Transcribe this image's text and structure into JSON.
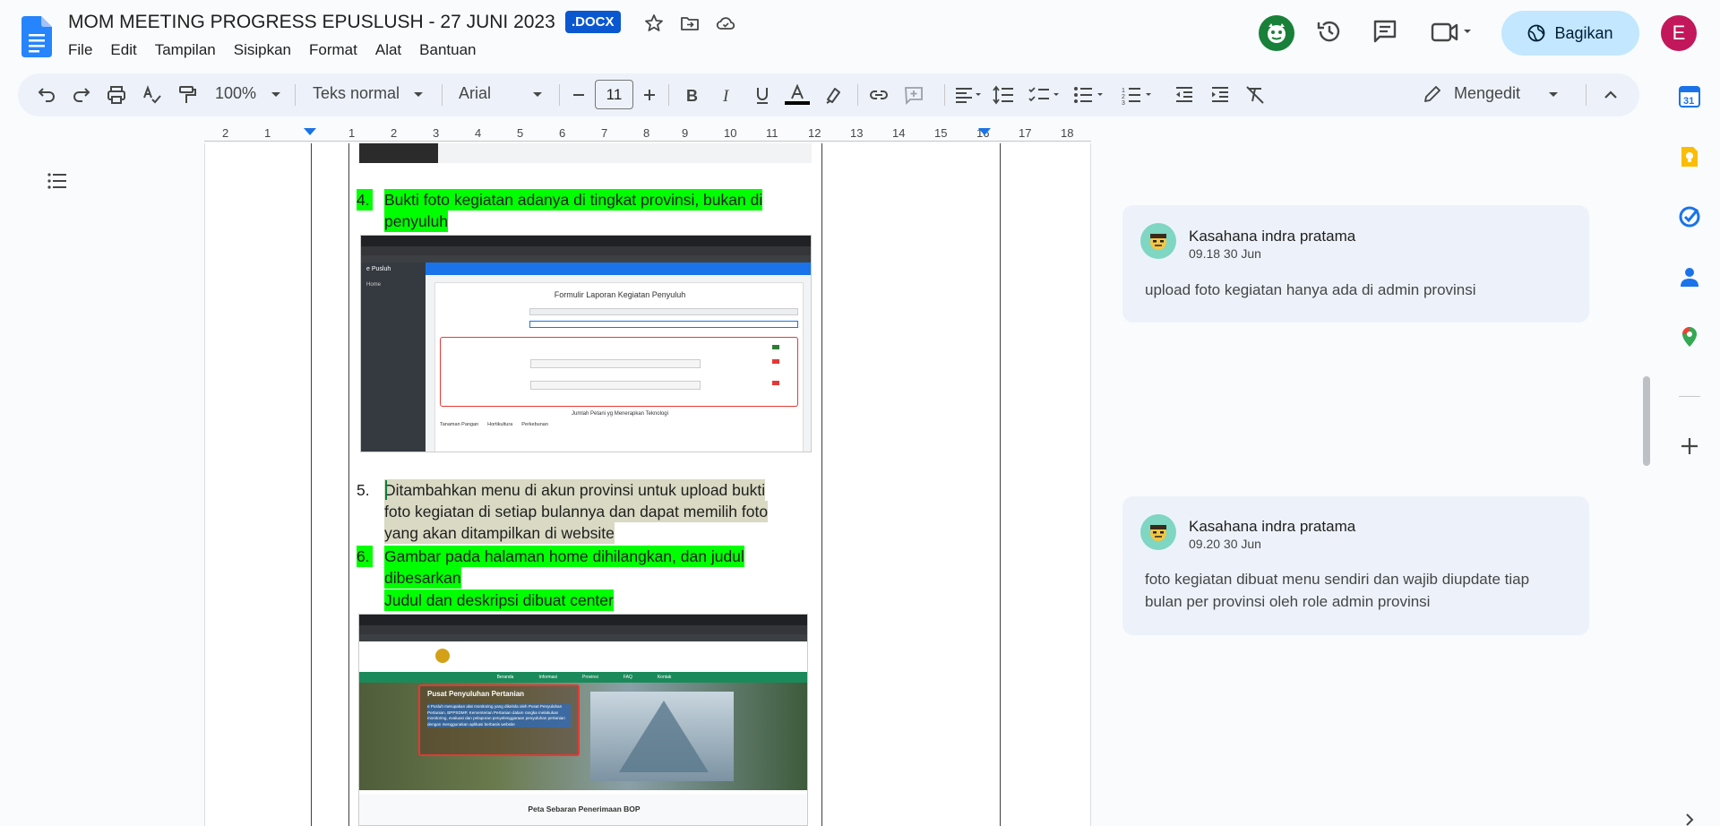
{
  "header": {
    "title": "MOM MEETING PROGRESS EPUSLUSH - 27 JUNI 2023",
    "badge": ".DOCX",
    "menu": [
      "File",
      "Edit",
      "Tampilan",
      "Sisipkan",
      "Format",
      "Alat",
      "Bantuan"
    ],
    "share_label": "Bagikan",
    "account_initial": "E"
  },
  "toolbar": {
    "zoom": "100%",
    "style": "Teks normal",
    "font": "Arial",
    "font_size": "11",
    "mode": "Mengedit"
  },
  "ruler": {
    "numbers": [
      "2",
      "1",
      "1",
      "2",
      "3",
      "4",
      "5",
      "6",
      "7",
      "8",
      "9",
      "10",
      "11",
      "12",
      "13",
      "14",
      "15",
      "16",
      "17",
      "18"
    ]
  },
  "document": {
    "items": [
      {
        "number": "4.",
        "lines": [
          "Bukti foto kegiatan adanya di tingkat provinsi, bukan di",
          "penyuluh"
        ]
      },
      {
        "number": "5.",
        "lines": [
          "Ditambahkan menu di akun provinsi untuk upload bukti",
          "foto kegiatan di setiap bulannya dan dapat memilih foto",
          "yang akan ditampilkan di website"
        ]
      },
      {
        "number": "6.",
        "lines": [
          "Gambar pada halaman home dihilangkan, dan judul",
          "dibesarkan",
          "Judul dan deskripsi dibuat center"
        ]
      }
    ],
    "screenshot1": {
      "app_name": "e Pusluh",
      "sidebar_item": "Home",
      "form_title": "Formulir Laporan Kegiatan Penyuluh",
      "tab_labels": [
        "Tanaman Pangan",
        "Hortikultura",
        "Perkebunan"
      ],
      "footer_label": "Jumlah Petani yg Menerapkan Teknologi"
    },
    "screenshot2": {
      "hero_title": "Pusat Penyuluhan Pertanian",
      "hero_text": "e Pusluh merupakan alat monitoring yang dikelola oleh Pusat Penyuluhan Pertanian, BPPSDMP, Kementerian Pertanian dalam rangka melakukan monitoring, evaluasi dan pelaporan penyelenggaraan penyuluhan pertanian dengan menggunakan aplikasi berbasis website",
      "nav": [
        "Beranda",
        "Informasi",
        "Provinsi",
        "FAQ",
        "Kontak"
      ],
      "caption": "Peta Sebaran Penerimaan BOP"
    }
  },
  "comments": [
    {
      "author": "Kasahana indra pratama",
      "time": "09.18 30 Jun",
      "body": "upload foto kegiatan hanya ada di admin provinsi"
    },
    {
      "author": "Kasahana indra pratama",
      "time": "09.20 30 Jun",
      "body": "foto kegiatan dibuat menu sendiri dan wajib diupdate tiap bulan per provinsi oleh role admin provinsi"
    }
  ],
  "colors": {
    "accent": "#0b57d0",
    "highlight_green": "#00ff00",
    "highlight_olive": "#d9d9c4",
    "share_bg": "#c2e7ff"
  }
}
